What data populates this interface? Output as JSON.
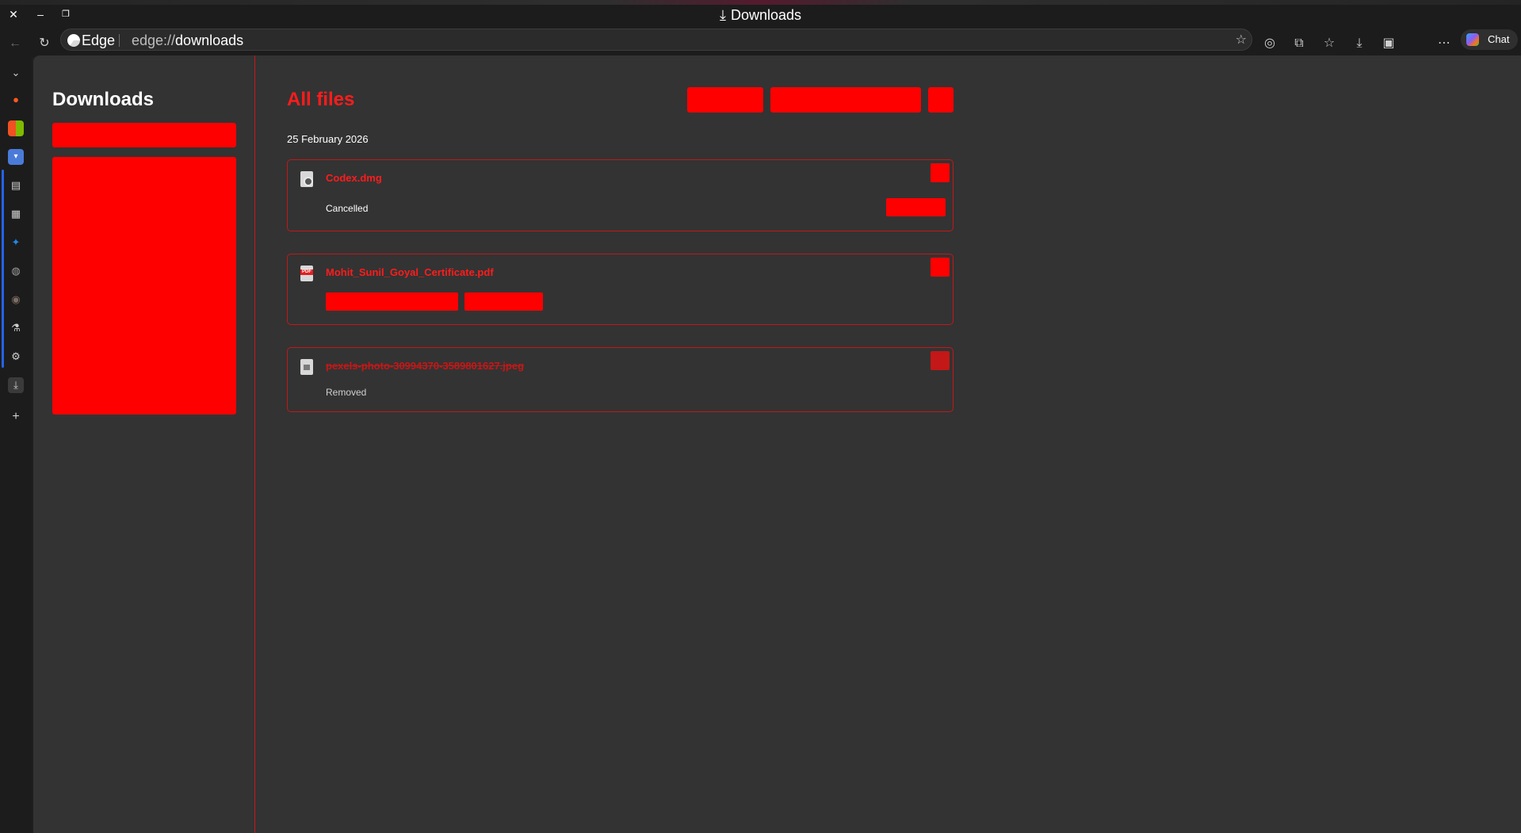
{
  "window": {
    "title": "Downloads",
    "close_glyph": "✕",
    "minimize_glyph": "–",
    "restore_glyph": "❐",
    "title_icon": "download-icon"
  },
  "toolbar": {
    "back_icon": "back-arrow-icon",
    "refresh_icon": "refresh-icon",
    "brand_label": "Edge",
    "address_scheme": "edge://",
    "address_path": "downloads",
    "favorite_icon": "star-icon",
    "right_icons": [
      "copilot-vision-icon",
      "extensions-icon",
      "favorites-icon",
      "downloads-icon",
      "screenshot-icon",
      "more-icon"
    ],
    "chat_label": "Chat"
  },
  "vertical_tabs": {
    "icons": [
      "collapse-icon",
      "duckduckgo-icon",
      "microsoft-icon",
      "dropdown-app-icon",
      "document-icon",
      "calendar-icon",
      "rocket-icon",
      "globe-icon",
      "fingerprint-icon",
      "flask-icon",
      "settings-icon",
      "download-icon",
      "add-tab-icon"
    ]
  },
  "sidebar": {
    "title": "Downloads"
  },
  "main": {
    "section_title": "All files",
    "date_group": "25 February 2026",
    "items": [
      {
        "name": "Codex.dmg",
        "status": "Cancelled",
        "icon": "disk-image-icon"
      },
      {
        "name": "Mohit_Sunil_Goyal_Certificate.pdf",
        "status": "",
        "icon": "pdf-file-icon"
      },
      {
        "name": "pexels-photo-30994370-3589801627.jpeg",
        "status": "Removed",
        "icon": "image-file-icon"
      }
    ]
  },
  "colors": {
    "accent_red": "#ff0000",
    "border_red": "#c41717",
    "panel_bg": "#333333",
    "chrome_bg": "#1c1c1c"
  }
}
